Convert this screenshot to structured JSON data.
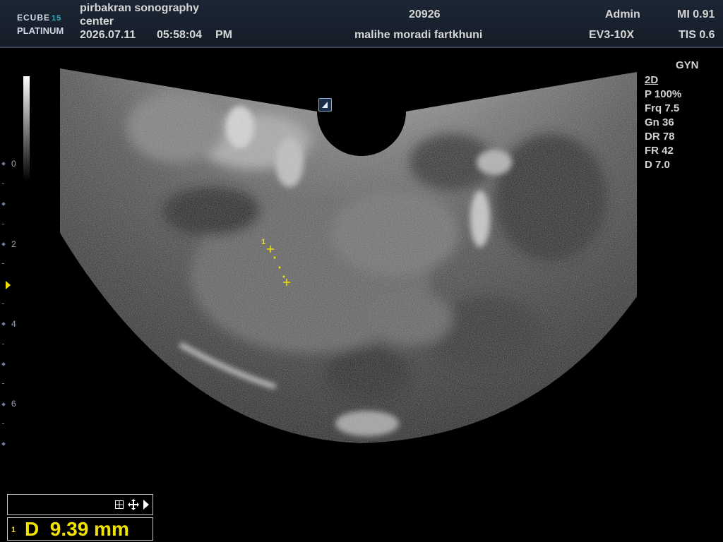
{
  "header": {
    "logo_line1": "ECUBE",
    "logo_line1_num": "15",
    "logo_line2": "PLATINUM",
    "institution_line1": "pirbakran sonography",
    "institution_line2": "center",
    "date": "2026.07.11",
    "time": "05:58:04",
    "ampm": "PM",
    "patient_id": "20926",
    "patient_name": "malihe moradi fartkhuni",
    "operator": "Admin",
    "probe": "EV3-10X",
    "mi": "MI 0.91",
    "tis": "TIS 0.6"
  },
  "preset": "GYN",
  "params": {
    "mode": "2D",
    "power": "P 100%",
    "frequency": "Frq 7.5",
    "gain": "Gn 36",
    "dynamic_range": "DR 78",
    "frame_rate": "FR 42",
    "depth": "D 7.0"
  },
  "depth_scale": {
    "labels": [
      "0",
      "2",
      "4",
      "6"
    ]
  },
  "measurement": {
    "caliper_index": "1",
    "result_index": "1",
    "result_text": "D  9.39 mm"
  },
  "icons": {
    "orientation": "orientation-marker-icon",
    "grid": "grid-icon",
    "move": "move-cross-icon",
    "next": "play-right-icon"
  },
  "colors": {
    "measurement": "#f2e400",
    "header_bg": "#1a2330",
    "scale": "#6a7ea0"
  }
}
